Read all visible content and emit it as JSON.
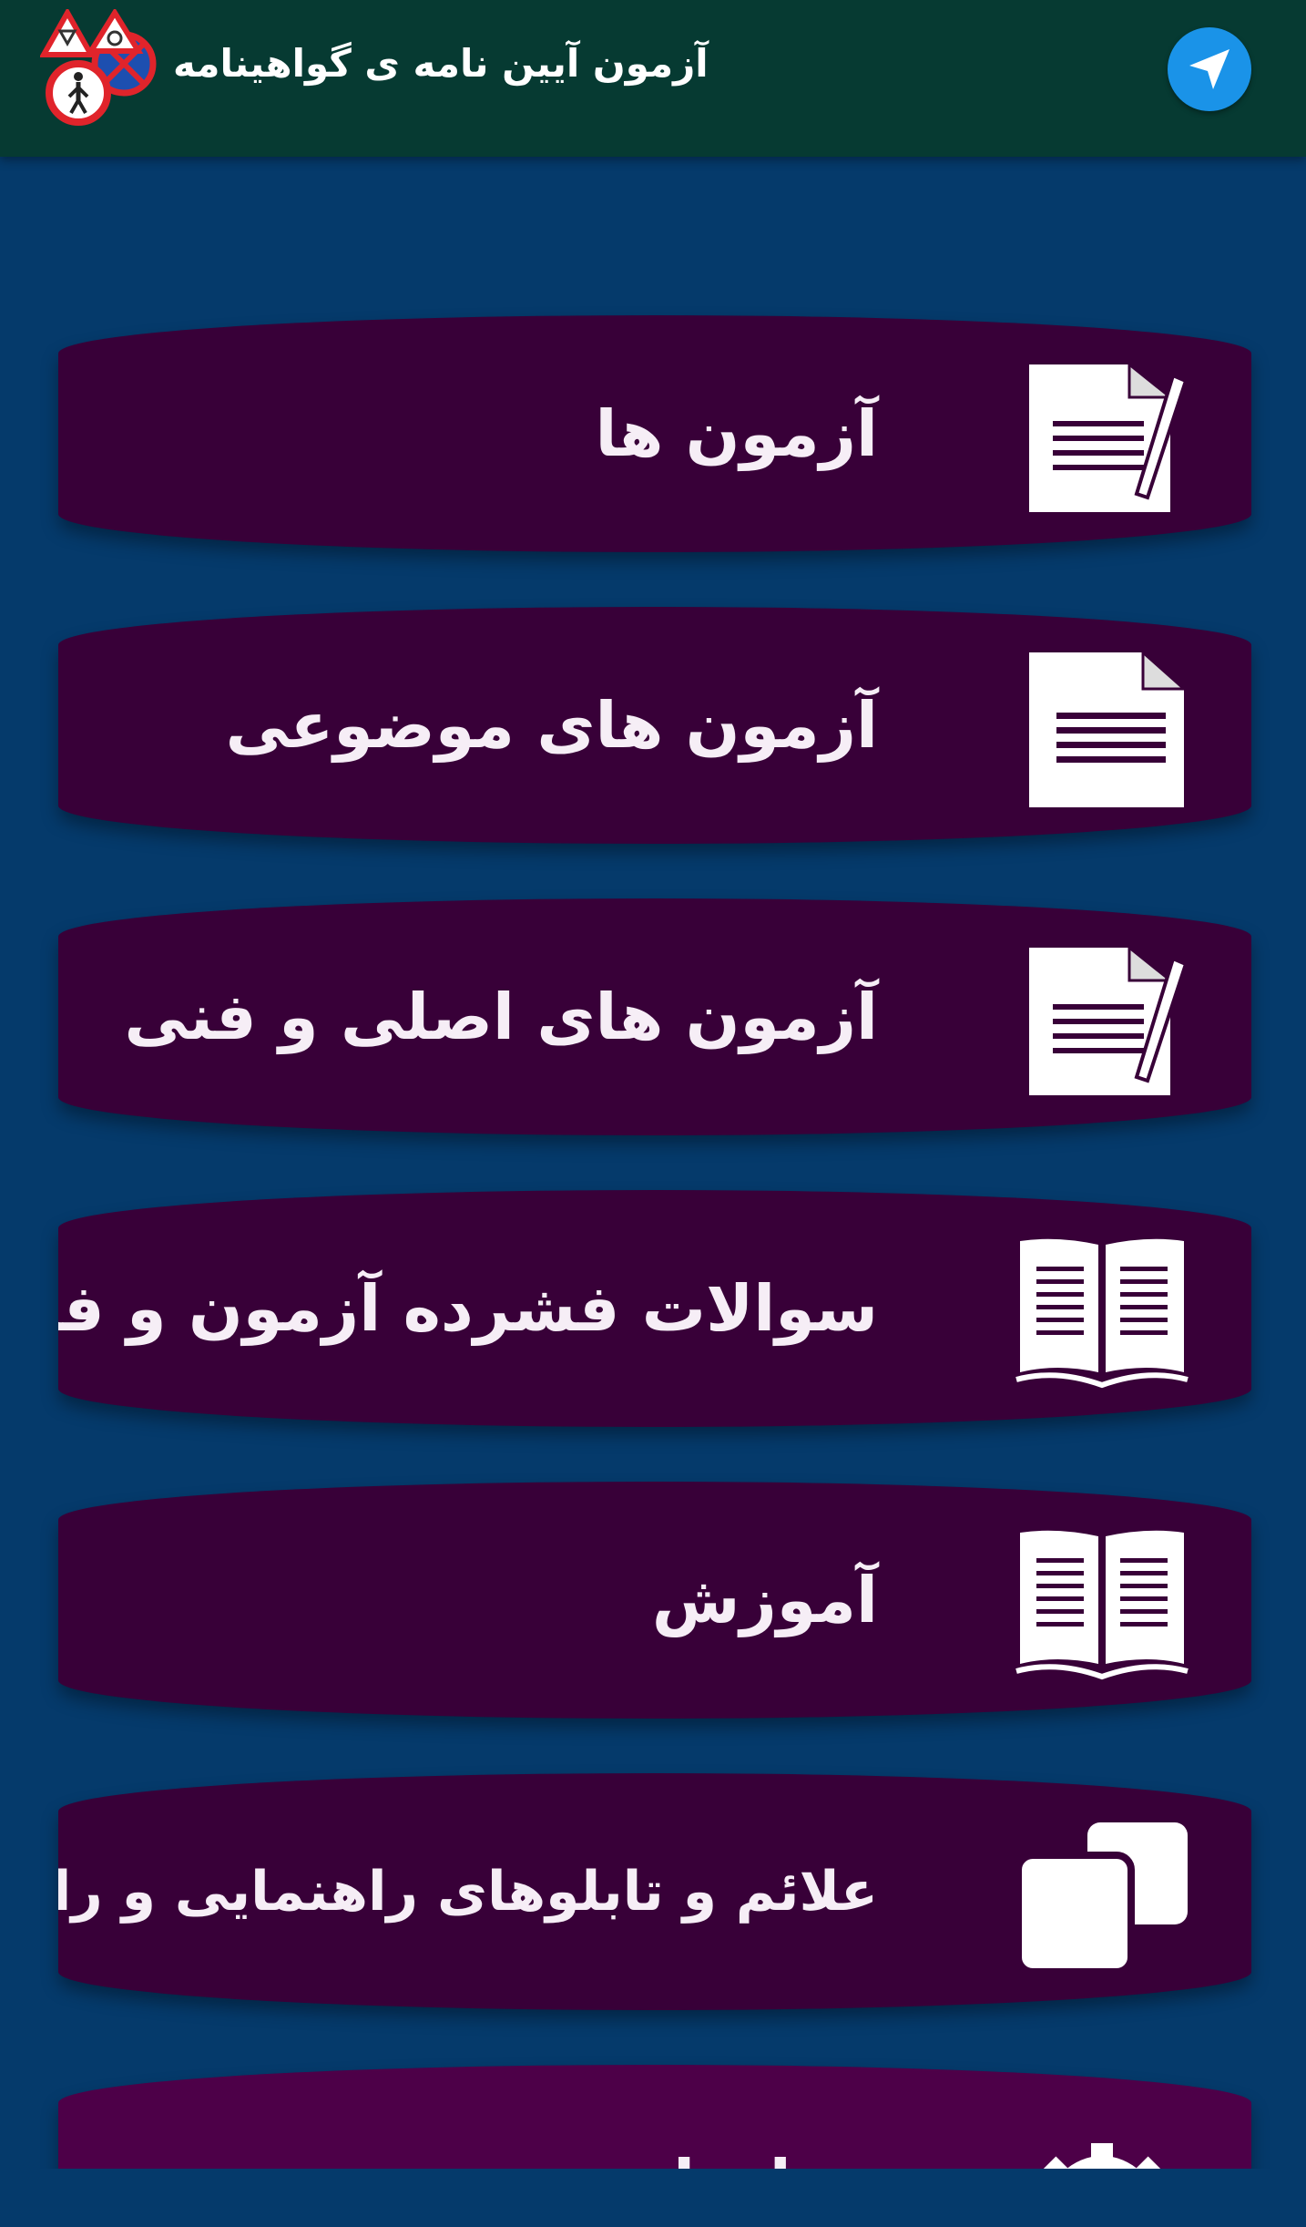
{
  "app_bar": {
    "title": "آزمون آیین نامه ی گواهینامه",
    "logo_icon": "traffic-signs-logo-icon",
    "nav_icon": "send-arrow-icon"
  },
  "menu": [
    {
      "label": "آزمون ها",
      "icon": "document-pen-icon"
    },
    {
      "label": "آزمون های موضوعی",
      "icon": "document-icon"
    },
    {
      "label": "آزمون های اصلی و فنی",
      "icon": "document-pen-icon"
    },
    {
      "label": "سوالات فشرده آزمون و فنی",
      "icon": "open-book-icon"
    },
    {
      "label": "آموزش",
      "icon": "open-book-icon"
    },
    {
      "label": "علائم و تابلوهای راهنمایی و رانندگی",
      "icon": "copy-squares-icon"
    },
    {
      "label": "تنظیمات",
      "icon": "gear-icon"
    }
  ],
  "colors": {
    "background": "#053a6b",
    "app_bar": "#063a32",
    "card": "#380038",
    "nav_button": "#1a93e8"
  }
}
